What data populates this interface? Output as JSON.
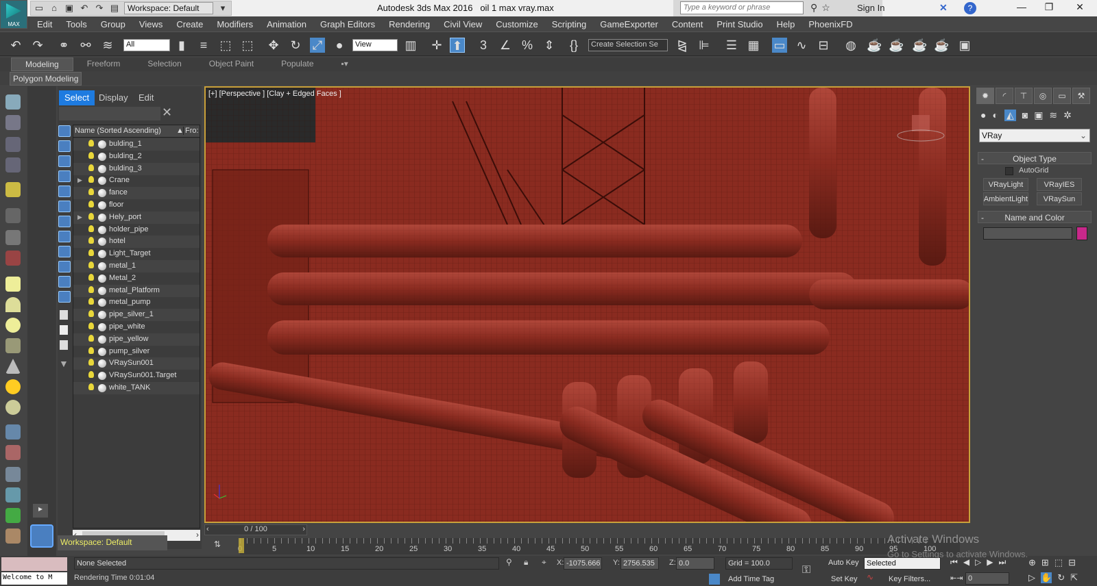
{
  "titlebar": {
    "app_title": "Autodesk 3ds Max 2016",
    "file": "oil 1 max vray.max",
    "logo": "MAX",
    "workspace": "Workspace: Default",
    "search_placeholder": "Type a keyword or phrase",
    "sign_in": "Sign In"
  },
  "menu": [
    "Edit",
    "Tools",
    "Group",
    "Views",
    "Create",
    "Modifiers",
    "Animation",
    "Graph Editors",
    "Rendering",
    "Civil View",
    "Customize",
    "Scripting",
    "GameExporter",
    "Content",
    "Print Studio",
    "Help",
    "PhoenixFD"
  ],
  "toolbar": {
    "filter": "All",
    "ref_coord": "View",
    "selection_set": "Create Selection Se"
  },
  "ribbon": {
    "tabs": [
      "Modeling",
      "Freeform",
      "Selection",
      "Object Paint",
      "Populate"
    ],
    "active": "Modeling",
    "panel": "Polygon Modeling"
  },
  "explorer": {
    "tabs": [
      "Select",
      "Display",
      "Edit"
    ],
    "column_name": "Name (Sorted Ascending)",
    "column_frozen": "Fro:",
    "items": [
      {
        "name": "bulding_1"
      },
      {
        "name": "bulding_2"
      },
      {
        "name": "bulding_3"
      },
      {
        "name": "Crane",
        "expandable": true
      },
      {
        "name": "fance"
      },
      {
        "name": "floor"
      },
      {
        "name": "Hely_port",
        "expandable": true
      },
      {
        "name": "holder_pipe"
      },
      {
        "name": "hotel"
      },
      {
        "name": "Light_Target"
      },
      {
        "name": "metal_1"
      },
      {
        "name": "Metal_2"
      },
      {
        "name": "metal_Platform"
      },
      {
        "name": "metal_pump"
      },
      {
        "name": "pipe_silver_1"
      },
      {
        "name": "pipe_white"
      },
      {
        "name": "pipe_yellow"
      },
      {
        "name": "pump_silver"
      },
      {
        "name": "VRaySun001"
      },
      {
        "name": "VRaySun001.Target"
      },
      {
        "name": "white_TANK"
      }
    ],
    "workspace": "Workspace: Default"
  },
  "viewport": {
    "label": "[+] [Perspective ] [Clay + Edged Faces ]",
    "bg_color": "#8a2b20",
    "border_color": "#c9a13a"
  },
  "command_panel": {
    "renderer": "VRay",
    "object_type": "Object Type",
    "autogrid": "AutoGrid",
    "buttons": [
      "VRayLight",
      "VRayIES",
      "VRayAmbientLight",
      "VRaySun"
    ],
    "name_color": "Name and Color",
    "color_swatch": "#c8288a"
  },
  "timeline": {
    "slider": "0 / 100",
    "current": 0,
    "end": 100,
    "labels": [
      "0",
      "5",
      "10",
      "15",
      "20",
      "25",
      "30",
      "35",
      "40",
      "45",
      "50",
      "55",
      "60",
      "65",
      "70",
      "75",
      "80",
      "85",
      "90",
      "95",
      "100"
    ]
  },
  "status": {
    "selection": "None Selected",
    "render_time": "Rendering Time  0:01:04",
    "maxscript": "Welcome to M",
    "x_label": "X:",
    "x": "-1075.666",
    "y_label": "Y:",
    "y": "2756.535",
    "z_label": "Z:",
    "z": "0.0",
    "grid": "Grid = 100.0",
    "add_time_tag": "Add Time Tag",
    "auto_key": "Auto Key",
    "set_key": "Set Key",
    "key_mode": "Selected",
    "key_filters": "Key Filters...",
    "frame": "0"
  },
  "watermark": {
    "line1": "Activate Windows",
    "line2": "Go to Settings to activate Windows."
  }
}
